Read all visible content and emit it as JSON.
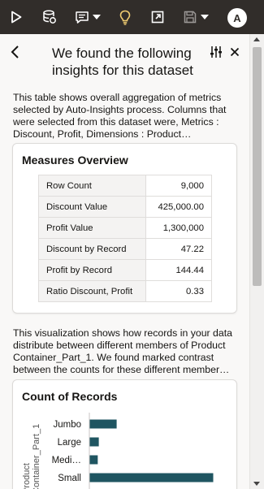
{
  "toolbar": {
    "icons": [
      "play-icon",
      "data-refresh-icon",
      "comment-icon",
      "chevron-down-icon",
      "lightbulb-icon",
      "export-icon",
      "save-icon",
      "chevron-down-icon"
    ],
    "avatar_initial": "A",
    "colors": {
      "background": "#312d2a",
      "icon": "#ffffff",
      "accent": "#f0cc71"
    }
  },
  "panel": {
    "title": "We found the following insights for this dataset",
    "intro": "This table shows overall aggregation of metrics selected by Auto-Insights process. Columns that were selected from this dataset were, Metrics : Discount, Profit, Dimensions : Product…",
    "measures_card": {
      "title": "Measures Overview",
      "rows": [
        {
          "label": "Row Count",
          "value": "9,000"
        },
        {
          "label": "Discount Value",
          "value": "425,000.00"
        },
        {
          "label": "Profit Value",
          "value": "1,300,000"
        },
        {
          "label": "Discount by Record",
          "value": "47.22"
        },
        {
          "label": "Profit by Record",
          "value": "144.44"
        },
        {
          "label": "Ratio Discount, Profit",
          "value": "0.33"
        }
      ]
    },
    "viz_desc": "This visualization shows how records in your data distribute between different members of Product Container_Part_1. We found marked contrast between the counts for these different member…",
    "count_card": {
      "title": "Count of Records"
    }
  },
  "chart_data": {
    "type": "bar",
    "orientation": "horizontal",
    "title": "Count of Records",
    "ylabel": "Product Container_Part_1",
    "categories": [
      "Jumbo",
      "Large",
      "Medi…",
      "Small"
    ],
    "values": [
      1300,
      450,
      400,
      5900
    ],
    "xlim": [
      0,
      6500
    ],
    "color": "#1f5561"
  }
}
